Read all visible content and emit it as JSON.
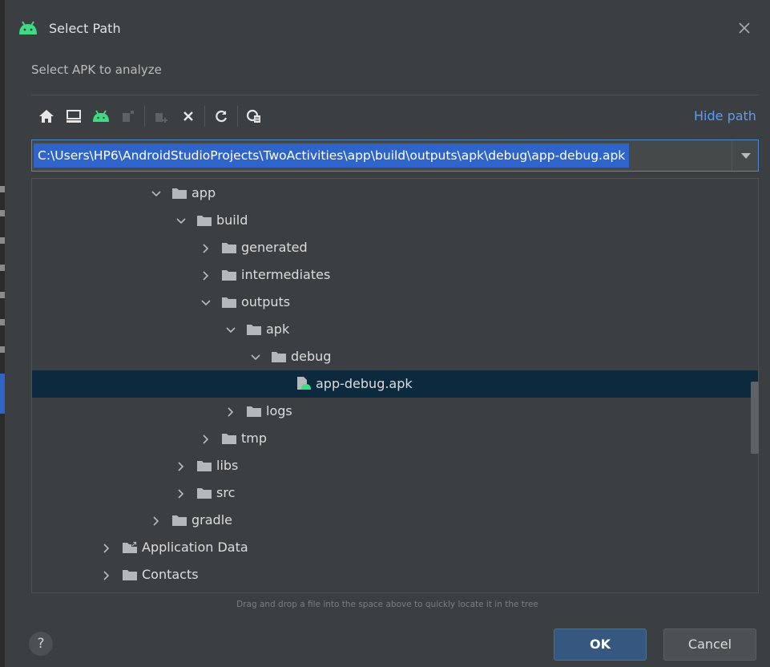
{
  "dialog": {
    "title": "Select Path",
    "subtitle": "Select APK to analyze",
    "close_icon": "close-icon",
    "app_icon": "android-icon"
  },
  "toolbar": {
    "buttons": [
      {
        "name": "home-icon"
      },
      {
        "name": "desktop-icon"
      },
      {
        "name": "android-project-icon"
      },
      {
        "name": "module-icon"
      },
      {
        "name": "new-folder-icon"
      },
      {
        "name": "delete-icon"
      },
      {
        "name": "refresh-icon"
      },
      {
        "name": "show-hidden-icon"
      }
    ],
    "hide_path_label": "Hide path"
  },
  "path": {
    "value": "C:\\Users\\HP6\\AndroidStudioProjects\\TwoActivities\\app\\build\\outputs\\apk\\debug\\app-debug.apk"
  },
  "tree": {
    "selected_index": 7,
    "items": [
      {
        "label": "app",
        "depth": 5,
        "expanded": true,
        "type": "folder"
      },
      {
        "label": "build",
        "depth": 6,
        "expanded": true,
        "type": "folder"
      },
      {
        "label": "generated",
        "depth": 7,
        "expanded": false,
        "type": "folder"
      },
      {
        "label": "intermediates",
        "depth": 7,
        "expanded": false,
        "type": "folder"
      },
      {
        "label": "outputs",
        "depth": 7,
        "expanded": true,
        "type": "folder"
      },
      {
        "label": "apk",
        "depth": 8,
        "expanded": true,
        "type": "folder"
      },
      {
        "label": "debug",
        "depth": 9,
        "expanded": true,
        "type": "folder"
      },
      {
        "label": "app-debug.apk",
        "depth": 10,
        "expanded": null,
        "type": "apk-file"
      },
      {
        "label": "logs",
        "depth": 8,
        "expanded": false,
        "type": "folder"
      },
      {
        "label": "tmp",
        "depth": 7,
        "expanded": false,
        "type": "folder"
      },
      {
        "label": "libs",
        "depth": 6,
        "expanded": false,
        "type": "folder"
      },
      {
        "label": "src",
        "depth": 6,
        "expanded": false,
        "type": "folder"
      },
      {
        "label": "gradle",
        "depth": 5,
        "expanded": false,
        "type": "folder"
      },
      {
        "label": "Application Data",
        "depth": 3,
        "expanded": false,
        "type": "shortcut-folder"
      },
      {
        "label": "Contacts",
        "depth": 3,
        "expanded": false,
        "type": "folder"
      }
    ]
  },
  "hint": "Drag and drop a file into the space above to quickly locate it in the tree",
  "buttons": {
    "help": "?",
    "ok": "OK",
    "cancel": "Cancel"
  },
  "colors": {
    "background": "#3c3f41",
    "selection": "#0d293e",
    "accent_link": "#589df6",
    "path_highlight": "#2f65ca",
    "android_green": "#3ddc84",
    "ok_button": "#365880"
  }
}
